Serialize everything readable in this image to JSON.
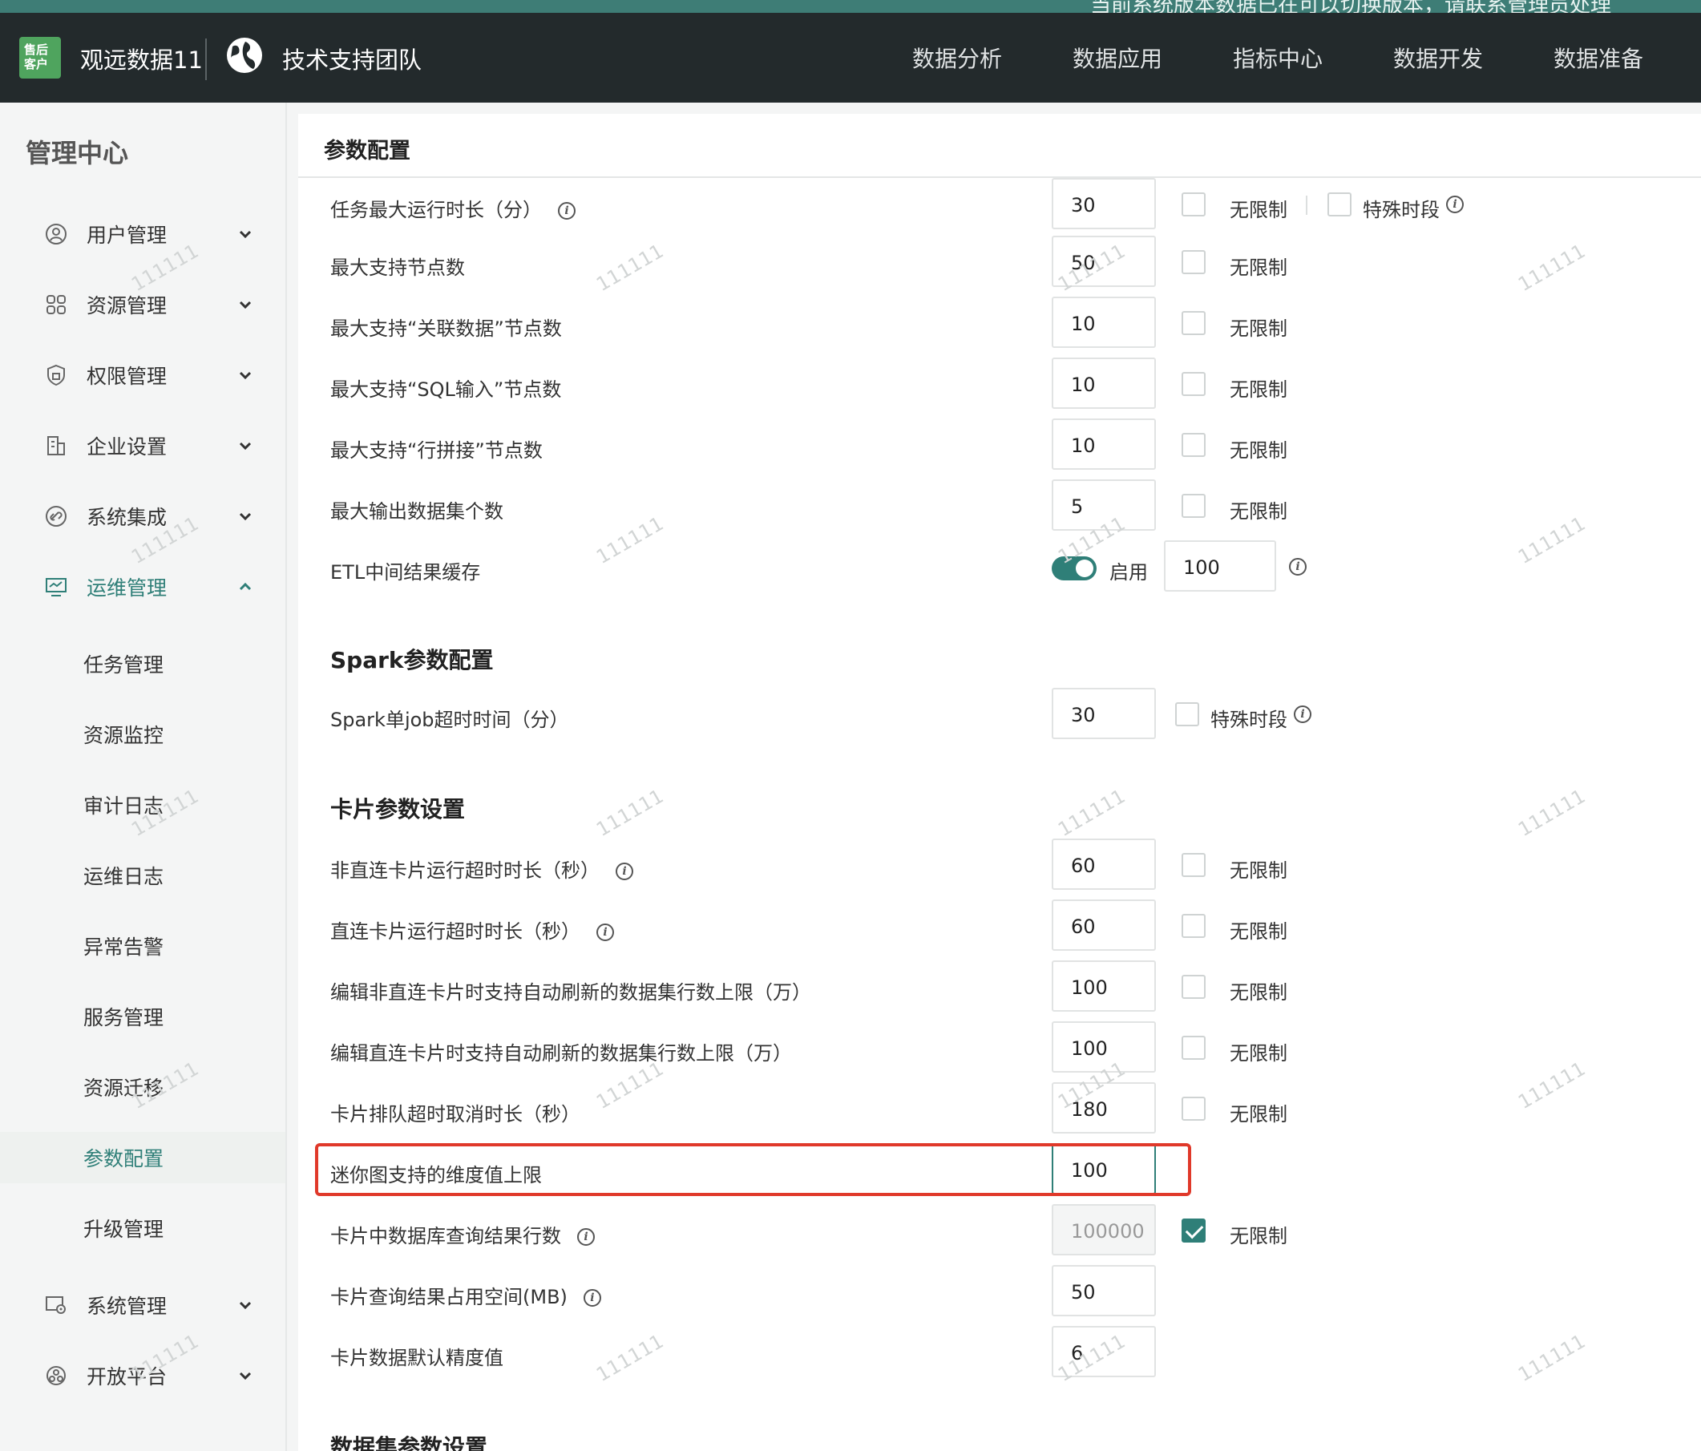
{
  "topstrip_text": "当前系统版本数据已在可以切换版本，请联系管理员处理",
  "header": {
    "logo_text": "售后客户",
    "brand": "观远数据11",
    "team": "技术支持团队",
    "nav": [
      "数据分析",
      "数据应用",
      "指标中心",
      "数据开发",
      "数据准备"
    ]
  },
  "sidebar": {
    "title": "管理中心",
    "groups": [
      {
        "label": "用户管理",
        "icon": "user-icon"
      },
      {
        "label": "资源管理",
        "icon": "grid-icon"
      },
      {
        "label": "权限管理",
        "icon": "shield-icon"
      },
      {
        "label": "企业设置",
        "icon": "building-icon"
      },
      {
        "label": "系统集成",
        "icon": "link-icon"
      },
      {
        "label": "运维管理",
        "icon": "monitor-icon"
      }
    ],
    "subitems": [
      "任务管理",
      "资源监控",
      "审计日志",
      "运维日志",
      "异常告警",
      "服务管理",
      "资源迁移",
      "参数配置",
      "升级管理"
    ],
    "bottom_groups": [
      {
        "label": "系统管理",
        "icon": "settings-icon"
      },
      {
        "label": "开放平台",
        "icon": "platform-icon"
      }
    ]
  },
  "main": {
    "title": "参数配置",
    "unlimited": "无限制",
    "special_period": "特殊时段",
    "enable": "启用",
    "rows_a": [
      {
        "label": "任务最大运行时长（分）",
        "value": "30"
      },
      {
        "label": "最大支持节点数",
        "value": "50"
      },
      {
        "label": "最大支持“关联数据”节点数",
        "value": "10"
      },
      {
        "label": "最大支持“SQL输入”节点数",
        "value": "10"
      },
      {
        "label": "最大支持“行拼接”节点数",
        "value": "10"
      },
      {
        "label": "最大输出数据集个数",
        "value": "5"
      }
    ],
    "etl": {
      "label": "ETL中间结果缓存",
      "value": "100"
    },
    "spark_title": "Spark参数配置",
    "spark_row": {
      "label": "Spark单job超时时间（分）",
      "value": "30"
    },
    "card_title": "卡片参数设置",
    "rows_c": [
      {
        "label": "非直连卡片运行超时时长（秒）",
        "value": "60"
      },
      {
        "label": "直连卡片运行超时时长（秒）",
        "value": "60"
      },
      {
        "label": "编辑非直连卡片时支持自动刷新的数据集行数上限（万）",
        "value": "100"
      },
      {
        "label": "编辑直连卡片时支持自动刷新的数据集行数上限（万）",
        "value": "100"
      },
      {
        "label": "卡片排队超时取消时长（秒）",
        "value": "180"
      },
      {
        "label": "迷你图支持的维度值上限",
        "value": "100"
      },
      {
        "label": "卡片中数据库查询结果行数",
        "value": "100000"
      },
      {
        "label": "卡片查询结果占用空间(MB)",
        "value": "50"
      },
      {
        "label": "卡片数据默认精度值",
        "value": "6"
      }
    ],
    "dataset_title": "数据集参数设置"
  },
  "watermark": "111111",
  "colors": {
    "accent": "#2f7f78",
    "header": "#232a2c",
    "highlight": "#e0392a"
  }
}
